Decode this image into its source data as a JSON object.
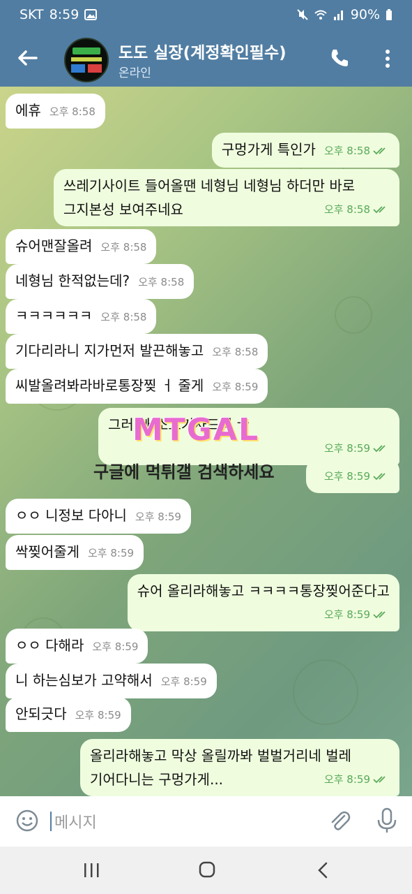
{
  "status_bar": {
    "carrier": "SKT",
    "time": "8:59",
    "battery": "90%"
  },
  "header": {
    "name": "도도 실장(계정확인필수)",
    "status": "온라인"
  },
  "messages": [
    {
      "dir": "in",
      "text": "에휴",
      "time": "오후 8:58"
    },
    {
      "dir": "out",
      "text": "구멍가게 특인가",
      "time": "오후 8:58"
    },
    {
      "dir": "out",
      "text1": "쓰레기사이트 들어올땐 네형님 네형님 하더만 바로",
      "text2": "그지본성 보여주네요",
      "time": "오후 8:58"
    },
    {
      "dir": "in",
      "text": "슈어맨잘올려",
      "time": "오후 8:58"
    },
    {
      "dir": "in",
      "text": "네형님 한적없는데?",
      "time": "오후 8:58"
    },
    {
      "dir": "in",
      "text": "ㅋㅋㅋㅋㅋㅋ",
      "time": "오후 8:58"
    },
    {
      "dir": "in",
      "text": "기다리라니 지가먼저 발끈해놓고",
      "time": "오후 8:58"
    },
    {
      "dir": "in",
      "text": "씨발올려봐라바로통장찢   ㅓ 줄게",
      "time": "오후 8:59"
    },
    {
      "dir": "out",
      "text": "그러                  빠 소고기사드려 ㅠ",
      "time": "오후 8:59"
    },
    {
      "dir": "out",
      "text": "",
      "time": "오후 8:59"
    },
    {
      "dir": "in",
      "text": "ㅇㅇ 니정보 다아니",
      "time": "오후 8:59"
    },
    {
      "dir": "in",
      "text": "싹찢어줄게",
      "time": "오후 8:59"
    },
    {
      "dir": "out",
      "text": "슈어 올리라해놓고 ㅋㅋㅋㅋ통장찢어준다고",
      "time": "오후 8:59"
    },
    {
      "dir": "in",
      "text": "ㅇㅇ 다해라",
      "time": "오후 8:59"
    },
    {
      "dir": "in",
      "text": "니 하는심보가 고약해서",
      "time": "오후 8:59"
    },
    {
      "dir": "in",
      "text": "안되긋다",
      "time": "오후 8:59"
    },
    {
      "dir": "out",
      "text1": "올리라해놓고 막상 올릴까봐 벌벌거리네 벌레",
      "text2": "기어다니는 구멍가게...",
      "time": "오후 8:59"
    }
  ],
  "watermark": {
    "logo": "MTGAL",
    "caption": "구글에 먹튀갤 검색하세요"
  },
  "input": {
    "placeholder": "메시지"
  },
  "colors": {
    "header": "#517da2",
    "outgoing_bubble": "#effdde",
    "incoming_bubble": "#ffffff"
  }
}
